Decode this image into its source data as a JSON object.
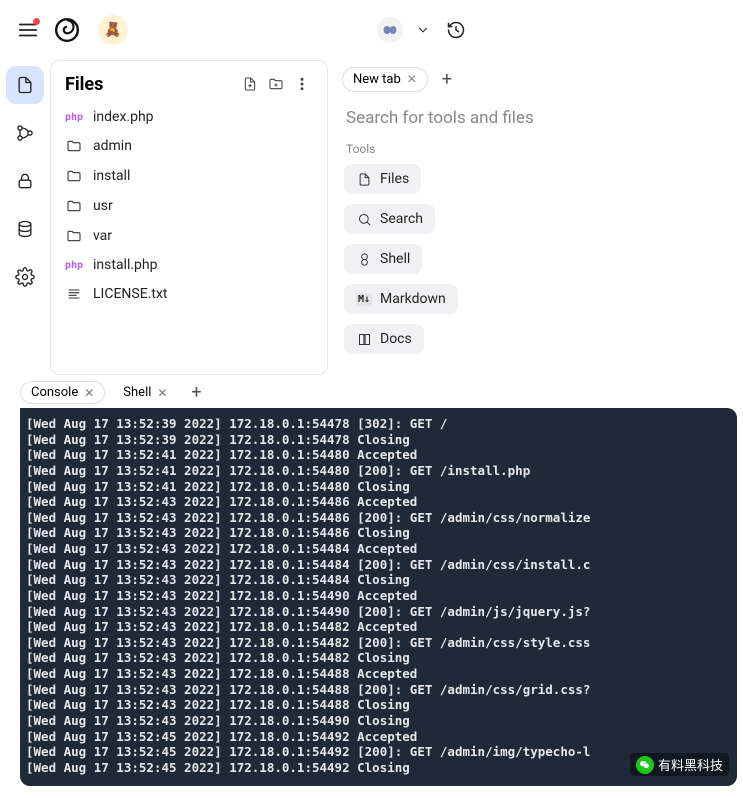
{
  "header": {
    "avatar_emoji": "🧸"
  },
  "files_panel": {
    "title": "Files",
    "items": [
      {
        "type": "php",
        "label": "index.php"
      },
      {
        "type": "folder",
        "label": "admin"
      },
      {
        "type": "folder",
        "label": "install"
      },
      {
        "type": "folder",
        "label": "usr"
      },
      {
        "type": "folder",
        "label": "var"
      },
      {
        "type": "php",
        "label": "install.php"
      },
      {
        "type": "text",
        "label": "LICENSE.txt"
      }
    ]
  },
  "right_panel": {
    "tab_label": "New tab",
    "search_placeholder": "Search for tools and files",
    "tools_heading": "Tools",
    "tools": [
      {
        "icon": "file",
        "label": "Files"
      },
      {
        "icon": "search",
        "label": "Search"
      },
      {
        "icon": "shell",
        "label": "Shell"
      },
      {
        "icon": "markdown",
        "label": "Markdown"
      },
      {
        "icon": "docs",
        "label": "Docs"
      }
    ]
  },
  "bottom_tabs": {
    "console": "Console",
    "shell": "Shell"
  },
  "console_lines": [
    "[Wed Aug 17 13:52:39 2022] 172.18.0.1:54478 [302]: GET /",
    "[Wed Aug 17 13:52:39 2022] 172.18.0.1:54478 Closing",
    "[Wed Aug 17 13:52:41 2022] 172.18.0.1:54480 Accepted",
    "[Wed Aug 17 13:52:41 2022] 172.18.0.1:54480 [200]: GET /install.php",
    "[Wed Aug 17 13:52:41 2022] 172.18.0.1:54480 Closing",
    "[Wed Aug 17 13:52:43 2022] 172.18.0.1:54486 Accepted",
    "[Wed Aug 17 13:52:43 2022] 172.18.0.1:54486 [200]: GET /admin/css/normalize",
    "[Wed Aug 17 13:52:43 2022] 172.18.0.1:54486 Closing",
    "[Wed Aug 17 13:52:43 2022] 172.18.0.1:54484 Accepted",
    "[Wed Aug 17 13:52:43 2022] 172.18.0.1:54484 [200]: GET /admin/css/install.c",
    "[Wed Aug 17 13:52:43 2022] 172.18.0.1:54484 Closing",
    "[Wed Aug 17 13:52:43 2022] 172.18.0.1:54490 Accepted",
    "[Wed Aug 17 13:52:43 2022] 172.18.0.1:54490 [200]: GET /admin/js/jquery.js?",
    "[Wed Aug 17 13:52:43 2022] 172.18.0.1:54482 Accepted",
    "[Wed Aug 17 13:52:43 2022] 172.18.0.1:54482 [200]: GET /admin/css/style.css",
    "[Wed Aug 17 13:52:43 2022] 172.18.0.1:54482 Closing",
    "[Wed Aug 17 13:52:43 2022] 172.18.0.1:54488 Accepted",
    "[Wed Aug 17 13:52:43 2022] 172.18.0.1:54488 [200]: GET /admin/css/grid.css?",
    "[Wed Aug 17 13:52:43 2022] 172.18.0.1:54488 Closing",
    "[Wed Aug 17 13:52:43 2022] 172.18.0.1:54490 Closing",
    "[Wed Aug 17 13:52:45 2022] 172.18.0.1:54492 Accepted",
    "[Wed Aug 17 13:52:45 2022] 172.18.0.1:54492 [200]: GET /admin/img/typecho-l",
    "[Wed Aug 17 13:52:45 2022] 172.18.0.1:54492 Closing"
  ],
  "watermark": "有料黑科技"
}
